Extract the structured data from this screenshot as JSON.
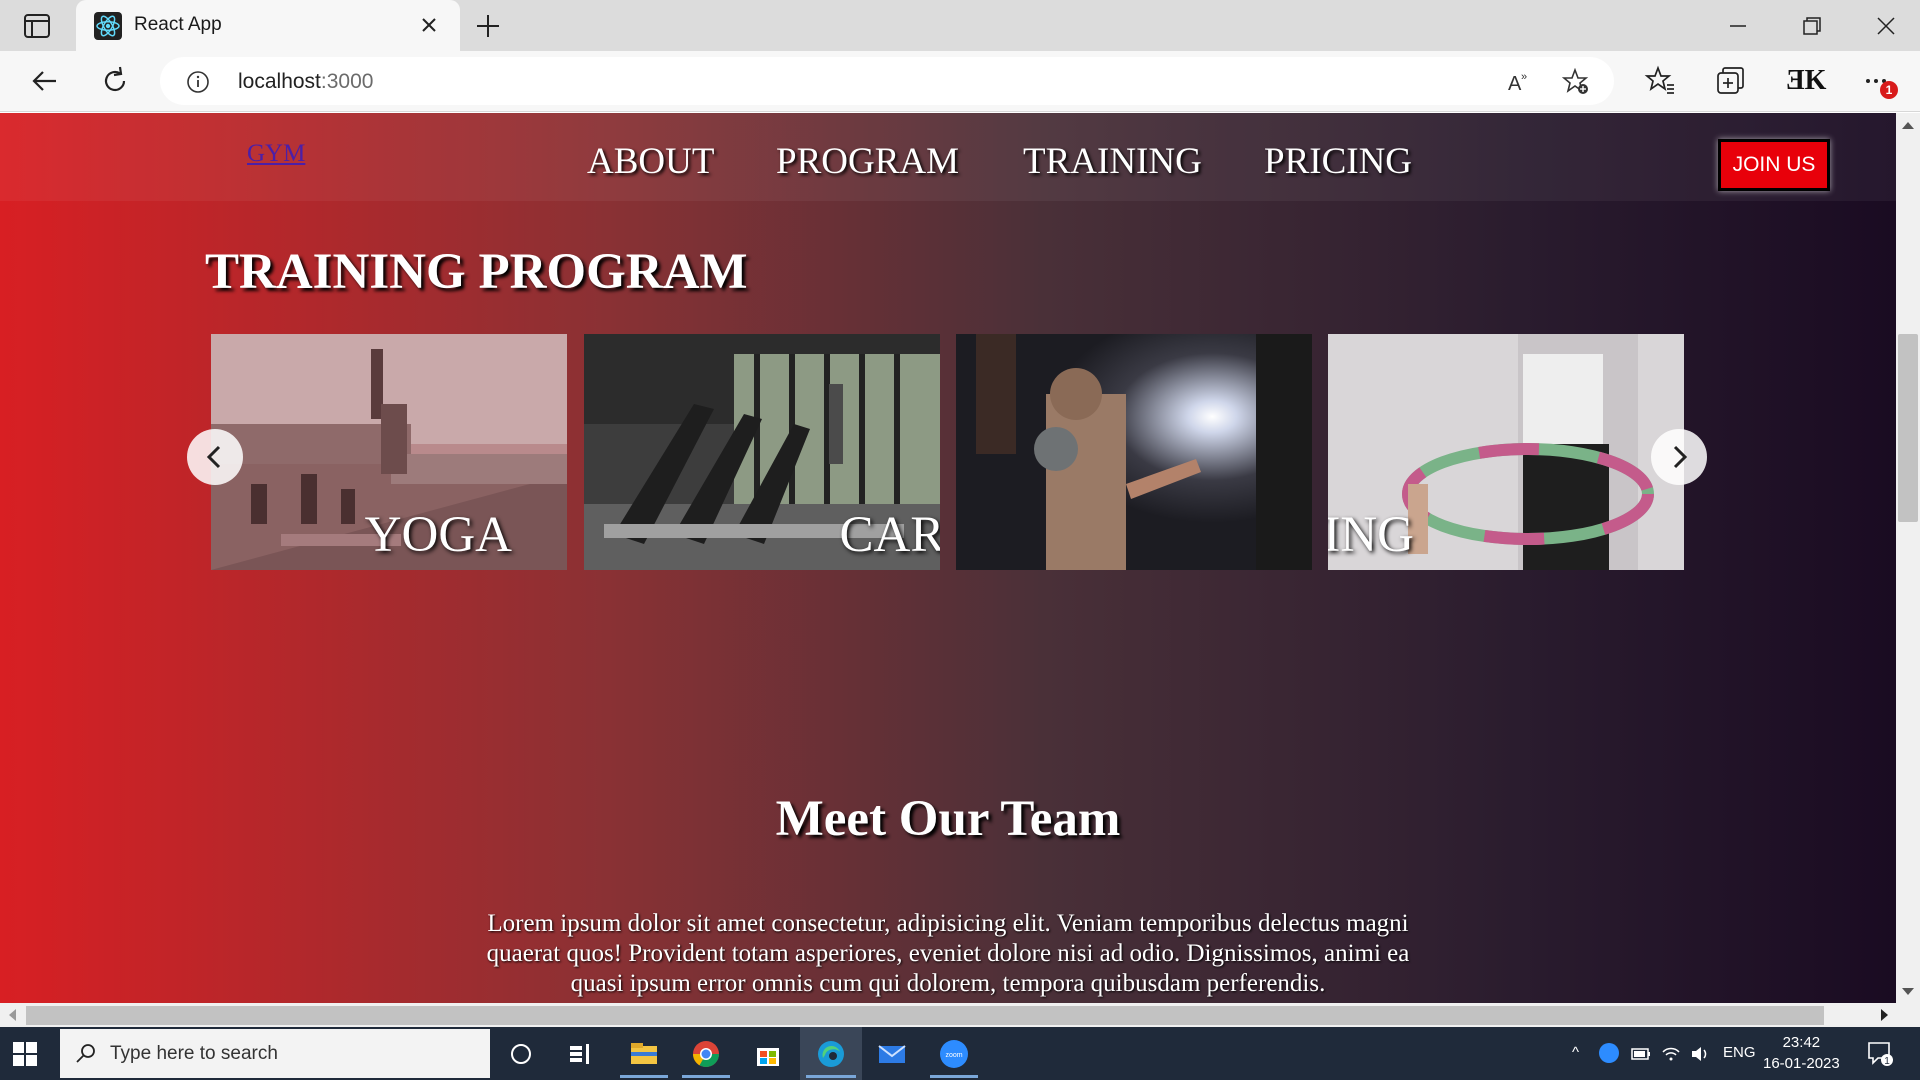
{
  "browser": {
    "tab_title": "React App",
    "url_host": "localhost",
    "url_port": ":3000",
    "profile_initials": "ƎK",
    "notification_badge": "1"
  },
  "site": {
    "logo": "GYM",
    "nav": [
      "ABOUT",
      "PROGRAM",
      "TRAINING",
      "PRICING"
    ],
    "join_button": "JOIN US",
    "section_title": "TRAINING PROGRAM",
    "cards": [
      "YOGA",
      "CARDIO",
      "",
      "BOXING"
    ],
    "team_title": "Meet Our Team",
    "team_text": "Lorem ipsum dolor sit amet consectetur, adipisicing elit. Veniam temporibus delectus magni quaerat quos! Provident totam asperiores, eveniet dolore nisi ad odio. Dignissimos, animi ea quasi ipsum error omnis cum qui dolorem, tempora quibusdam perferendis."
  },
  "taskbar": {
    "search_placeholder": "Type here to search",
    "language": "ENG",
    "time": "23:42",
    "date": "16-01-2023",
    "notification_count": "1"
  },
  "colors": {
    "accent_red": "#e8000a",
    "gradient_start": "#d81f23",
    "gradient_end": "#1a0b22"
  }
}
